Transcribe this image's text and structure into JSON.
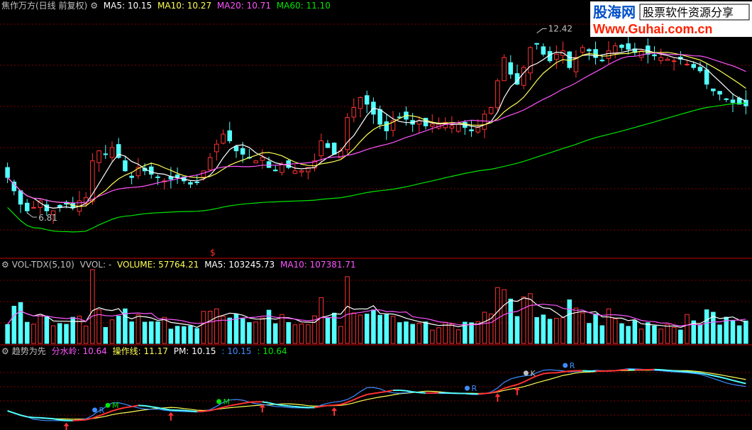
{
  "colors": {
    "up": "#ff3232",
    "down": "#54ffff",
    "ma5": "#ffffff",
    "ma10": "#ffff54",
    "ma20": "#ff54ff",
    "ma60": "#00e600",
    "grid": "#7f0000",
    "separator": "#c80000"
  },
  "price_panel": {
    "title": "焦作万方(日线 前复权)",
    "ma5_label": "MA5: 10.15",
    "ma10_label": "MA10: 10.27",
    "ma20_label": "MA20: 10.71",
    "ma60_label": "MA60: 11.10",
    "high_label": "12.42",
    "low_label": "6.81"
  },
  "volume_panel": {
    "title": "VOL-TDX(5,10)",
    "vvol_label": "VVOL: -",
    "volume_label": "VOLUME: 57764.21",
    "ma5_label": "MA5: 103245.73",
    "ma10_label": "MA10: 107381.71",
    "marker": "$"
  },
  "indicator_panel": {
    "title": "趋势为先",
    "fenshuiling_label": "分水岭: 10.64",
    "caozuoxian_label": "操作线: 11.17",
    "pm_label": "PM: 10.15",
    "extra1_label": ": 10.15",
    "extra2_label": ": 10.64",
    "signal_r": "R",
    "signal_m": "M",
    "signal_k": "K"
  },
  "watermark": {
    "brand": "股海网",
    "slogan": "股票软件资源分享",
    "url": "Www.Guhai.com.cn"
  },
  "chart_data": {
    "type": "candlestick",
    "high": 12.42,
    "low": 6.81,
    "ma5": 10.15,
    "ma10": 10.27,
    "ma20": 10.71,
    "ma60": 11.1,
    "volume": 57764.21,
    "vol_ma5": 103245.73,
    "vol_ma10": 107381.71,
    "closes": [
      8.0,
      7.6,
      7.2,
      7.0,
      7.1,
      7.3,
      7.0,
      7.0,
      7.1,
      7.2,
      7.1,
      7.3,
      7.4,
      8.5,
      8.8,
      8.7,
      8.9,
      8.6,
      8.2,
      8.0,
      8.3,
      8.2,
      8.1,
      8.0,
      7.9,
      7.95,
      8.0,
      7.9,
      7.8,
      7.85,
      8.2,
      8.6,
      9.0,
      9.3,
      9.1,
      8.8,
      8.7,
      8.6,
      8.5,
      8.6,
      8.3,
      8.2,
      8.4,
      8.3,
      8.2,
      8.2,
      8.3,
      8.5,
      9.1,
      8.9,
      8.7,
      8.8,
      9.8,
      10.1,
      10.4,
      10.2,
      9.9,
      9.6,
      9.4,
      9.7,
      9.8,
      9.75,
      9.6,
      9.7,
      9.55,
      9.6,
      9.6,
      9.65,
      9.55,
      9.6,
      9.5,
      9.4,
      9.5,
      9.9,
      10.1,
      10.9,
      11.6,
      11.1,
      10.8,
      11.3,
      11.9,
      12.0,
      11.7,
      11.5,
      11.7,
      11.8,
      11.3,
      11.6,
      11.9,
      11.8,
      11.6,
      11.5,
      11.8,
      11.95,
      11.9,
      11.85,
      11.75,
      11.8,
      11.7,
      11.65,
      11.6,
      11.55,
      11.5,
      11.55,
      11.4,
      11.3,
      11.2,
      10.8,
      10.6,
      10.5,
      10.35,
      10.25,
      10.2,
      10.15
    ]
  }
}
